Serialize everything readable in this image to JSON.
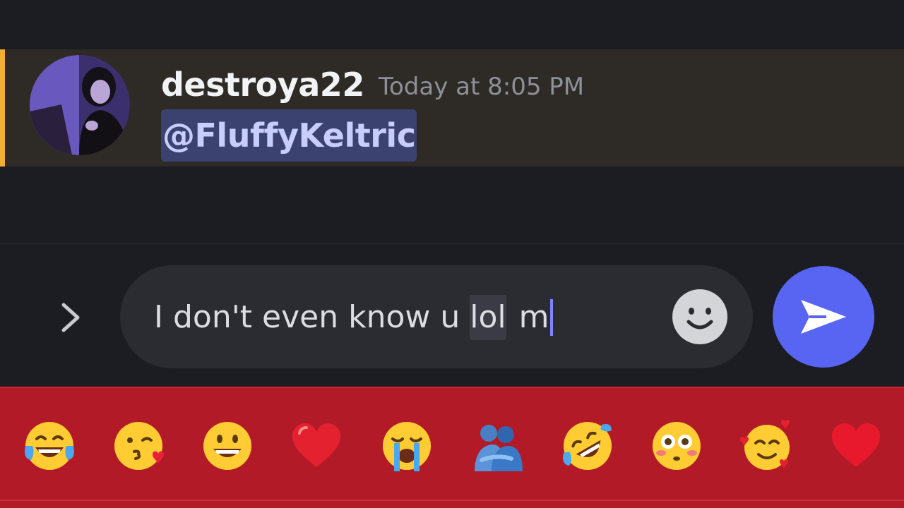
{
  "message": {
    "username": "destroya22",
    "timestamp": "Today at 8:05 PM",
    "mention": "@FluffyKeltric"
  },
  "composer": {
    "text_before": "I don't even know u ",
    "text_selected": "lol",
    "text_after": " m",
    "expand_icon": "chevron-right-icon",
    "emoji_icon": "smiley-icon",
    "send_icon": "send-arrow-icon"
  },
  "emoji_bar": {
    "items": [
      "face-with-tears-of-joy",
      "face-blowing-a-kiss",
      "grinning-face",
      "red-heart",
      "loudly-crying-face",
      "people-hugging",
      "rolling-on-the-floor-laughing",
      "flushed-face",
      "smiling-face-with-hearts",
      "heart"
    ]
  },
  "colors": {
    "accent": "#5865f2",
    "mention_highlight": "#f0b132",
    "emoji_bar_bg": "#b31a27"
  }
}
